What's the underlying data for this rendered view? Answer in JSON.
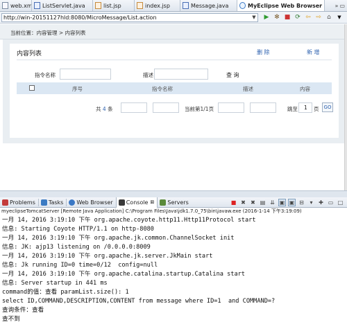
{
  "editor_tabs": [
    {
      "label": "web.xml",
      "icon": "xml-file-icon",
      "kind": "xml",
      "active": false
    },
    {
      "label": "ListServlet.java",
      "icon": "java-file-icon",
      "kind": "java",
      "active": false
    },
    {
      "label": "list.jsp",
      "icon": "jsp-file-icon",
      "kind": "jsp",
      "active": false
    },
    {
      "label": "index.jsp",
      "icon": "jsp-file-icon",
      "kind": "jsp",
      "active": false
    },
    {
      "label": "Message.java",
      "icon": "java-file-icon",
      "kind": "java",
      "active": false
    },
    {
      "label": "MyEclipse Web Browser",
      "icon": "globe-icon",
      "kind": "web",
      "active": true
    }
  ],
  "browser": {
    "url": "http://win-20151127hld:8080/MicroMessage/List.action",
    "breadcrumb": "当前位置：内容管理 > 内容列表",
    "panel_title": "内容列表",
    "delete_link": "删 除",
    "add_link": "新 增",
    "filter": {
      "command_label": "指令名称",
      "command_value": "",
      "description_label": "描述",
      "description_value": "",
      "query_button": "查 询"
    },
    "table_headers": [
      "序号",
      "指令名称",
      "描述",
      "内容"
    ],
    "pager": {
      "total_prefix": "共",
      "total_count": "4",
      "total_suffix": "条",
      "current_page": "当前第1/1页",
      "jump_label": "跳至",
      "page_value": "1",
      "page_unit": "页",
      "go_button": "GO"
    }
  },
  "views": {
    "tabs": [
      {
        "label": "Problems",
        "icon": "problems-icon",
        "color": "#c33b3b",
        "active": false
      },
      {
        "label": "Tasks",
        "icon": "tasks-icon",
        "color": "#3b7bc3",
        "active": false
      },
      {
        "label": "Web Browser",
        "icon": "globe-icon",
        "color": "#3a78c5",
        "active": false
      },
      {
        "label": "Console",
        "icon": "console-icon",
        "color": "#3a3a3a",
        "active": true
      },
      {
        "label": "Servers",
        "icon": "servers-icon",
        "color": "#5a8a3a",
        "active": false
      }
    ],
    "console_close": "⊠"
  },
  "console": {
    "header": "myeclipseTomcatServer [Remote Java Application] C:\\Program Files\\Java\\jdk1.7.0_75\\bin\\javaw.exe (2016-1-14 下午3:19:09)",
    "lines": [
      {
        "text": "一月 14, 2016 3:19:10 下午 org.apache.coyote.http11.Http11Protocol start",
        "err": false
      },
      {
        "text": "信息: Starting Coyote HTTP/1.1 on http-8080",
        "err": false
      },
      {
        "text": "一月 14, 2016 3:19:10 下午 org.apache.jk.common.ChannelSocket init",
        "err": false
      },
      {
        "text": "信息: JK: ajp13 listening on /0.0.0.0:8009",
        "err": false
      },
      {
        "text": "一月 14, 2016 3:19:10 下午 org.apache.jk.server.JkMain start",
        "err": false
      },
      {
        "text": "信息: Jk running ID=0 time=0/12  config=null",
        "err": false
      },
      {
        "text": "一月 14, 2016 3:19:10 下午 org.apache.catalina.startup.Catalina start",
        "err": false
      },
      {
        "text": "信息: Server startup in 441 ms",
        "err": false
      },
      {
        "text": "command的值：查看 paramList.size(): 1",
        "err": false
      },
      {
        "text": "select ID,COMMAND,DESCRIPTION,CONTENT from message where ID=1  and COMMAND=?",
        "err": false
      },
      {
        "text": "查询条件：查看",
        "err": false
      },
      {
        "text": "查不到",
        "err": false
      }
    ]
  }
}
